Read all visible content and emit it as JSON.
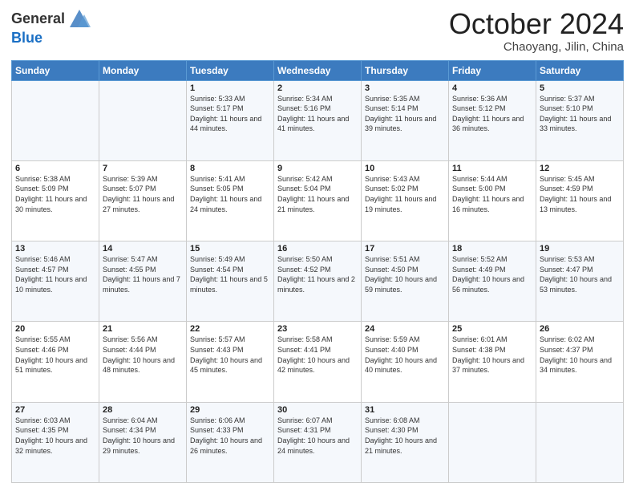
{
  "logo": {
    "general": "General",
    "blue": "Blue"
  },
  "header": {
    "month": "October 2024",
    "location": "Chaoyang, Jilin, China"
  },
  "weekdays": [
    "Sunday",
    "Monday",
    "Tuesday",
    "Wednesday",
    "Thursday",
    "Friday",
    "Saturday"
  ],
  "weeks": [
    [
      {
        "day": "",
        "sunrise": "",
        "sunset": "",
        "daylight": ""
      },
      {
        "day": "",
        "sunrise": "",
        "sunset": "",
        "daylight": ""
      },
      {
        "day": "1",
        "sunrise": "Sunrise: 5:33 AM",
        "sunset": "Sunset: 5:17 PM",
        "daylight": "Daylight: 11 hours and 44 minutes."
      },
      {
        "day": "2",
        "sunrise": "Sunrise: 5:34 AM",
        "sunset": "Sunset: 5:16 PM",
        "daylight": "Daylight: 11 hours and 41 minutes."
      },
      {
        "day": "3",
        "sunrise": "Sunrise: 5:35 AM",
        "sunset": "Sunset: 5:14 PM",
        "daylight": "Daylight: 11 hours and 39 minutes."
      },
      {
        "day": "4",
        "sunrise": "Sunrise: 5:36 AM",
        "sunset": "Sunset: 5:12 PM",
        "daylight": "Daylight: 11 hours and 36 minutes."
      },
      {
        "day": "5",
        "sunrise": "Sunrise: 5:37 AM",
        "sunset": "Sunset: 5:10 PM",
        "daylight": "Daylight: 11 hours and 33 minutes."
      }
    ],
    [
      {
        "day": "6",
        "sunrise": "Sunrise: 5:38 AM",
        "sunset": "Sunset: 5:09 PM",
        "daylight": "Daylight: 11 hours and 30 minutes."
      },
      {
        "day": "7",
        "sunrise": "Sunrise: 5:39 AM",
        "sunset": "Sunset: 5:07 PM",
        "daylight": "Daylight: 11 hours and 27 minutes."
      },
      {
        "day": "8",
        "sunrise": "Sunrise: 5:41 AM",
        "sunset": "Sunset: 5:05 PM",
        "daylight": "Daylight: 11 hours and 24 minutes."
      },
      {
        "day": "9",
        "sunrise": "Sunrise: 5:42 AM",
        "sunset": "Sunset: 5:04 PM",
        "daylight": "Daylight: 11 hours and 21 minutes."
      },
      {
        "day": "10",
        "sunrise": "Sunrise: 5:43 AM",
        "sunset": "Sunset: 5:02 PM",
        "daylight": "Daylight: 11 hours and 19 minutes."
      },
      {
        "day": "11",
        "sunrise": "Sunrise: 5:44 AM",
        "sunset": "Sunset: 5:00 PM",
        "daylight": "Daylight: 11 hours and 16 minutes."
      },
      {
        "day": "12",
        "sunrise": "Sunrise: 5:45 AM",
        "sunset": "Sunset: 4:59 PM",
        "daylight": "Daylight: 11 hours and 13 minutes."
      }
    ],
    [
      {
        "day": "13",
        "sunrise": "Sunrise: 5:46 AM",
        "sunset": "Sunset: 4:57 PM",
        "daylight": "Daylight: 11 hours and 10 minutes."
      },
      {
        "day": "14",
        "sunrise": "Sunrise: 5:47 AM",
        "sunset": "Sunset: 4:55 PM",
        "daylight": "Daylight: 11 hours and 7 minutes."
      },
      {
        "day": "15",
        "sunrise": "Sunrise: 5:49 AM",
        "sunset": "Sunset: 4:54 PM",
        "daylight": "Daylight: 11 hours and 5 minutes."
      },
      {
        "day": "16",
        "sunrise": "Sunrise: 5:50 AM",
        "sunset": "Sunset: 4:52 PM",
        "daylight": "Daylight: 11 hours and 2 minutes."
      },
      {
        "day": "17",
        "sunrise": "Sunrise: 5:51 AM",
        "sunset": "Sunset: 4:50 PM",
        "daylight": "Daylight: 10 hours and 59 minutes."
      },
      {
        "day": "18",
        "sunrise": "Sunrise: 5:52 AM",
        "sunset": "Sunset: 4:49 PM",
        "daylight": "Daylight: 10 hours and 56 minutes."
      },
      {
        "day": "19",
        "sunrise": "Sunrise: 5:53 AM",
        "sunset": "Sunset: 4:47 PM",
        "daylight": "Daylight: 10 hours and 53 minutes."
      }
    ],
    [
      {
        "day": "20",
        "sunrise": "Sunrise: 5:55 AM",
        "sunset": "Sunset: 4:46 PM",
        "daylight": "Daylight: 10 hours and 51 minutes."
      },
      {
        "day": "21",
        "sunrise": "Sunrise: 5:56 AM",
        "sunset": "Sunset: 4:44 PM",
        "daylight": "Daylight: 10 hours and 48 minutes."
      },
      {
        "day": "22",
        "sunrise": "Sunrise: 5:57 AM",
        "sunset": "Sunset: 4:43 PM",
        "daylight": "Daylight: 10 hours and 45 minutes."
      },
      {
        "day": "23",
        "sunrise": "Sunrise: 5:58 AM",
        "sunset": "Sunset: 4:41 PM",
        "daylight": "Daylight: 10 hours and 42 minutes."
      },
      {
        "day": "24",
        "sunrise": "Sunrise: 5:59 AM",
        "sunset": "Sunset: 4:40 PM",
        "daylight": "Daylight: 10 hours and 40 minutes."
      },
      {
        "day": "25",
        "sunrise": "Sunrise: 6:01 AM",
        "sunset": "Sunset: 4:38 PM",
        "daylight": "Daylight: 10 hours and 37 minutes."
      },
      {
        "day": "26",
        "sunrise": "Sunrise: 6:02 AM",
        "sunset": "Sunset: 4:37 PM",
        "daylight": "Daylight: 10 hours and 34 minutes."
      }
    ],
    [
      {
        "day": "27",
        "sunrise": "Sunrise: 6:03 AM",
        "sunset": "Sunset: 4:35 PM",
        "daylight": "Daylight: 10 hours and 32 minutes."
      },
      {
        "day": "28",
        "sunrise": "Sunrise: 6:04 AM",
        "sunset": "Sunset: 4:34 PM",
        "daylight": "Daylight: 10 hours and 29 minutes."
      },
      {
        "day": "29",
        "sunrise": "Sunrise: 6:06 AM",
        "sunset": "Sunset: 4:33 PM",
        "daylight": "Daylight: 10 hours and 26 minutes."
      },
      {
        "day": "30",
        "sunrise": "Sunrise: 6:07 AM",
        "sunset": "Sunset: 4:31 PM",
        "daylight": "Daylight: 10 hours and 24 minutes."
      },
      {
        "day": "31",
        "sunrise": "Sunrise: 6:08 AM",
        "sunset": "Sunset: 4:30 PM",
        "daylight": "Daylight: 10 hours and 21 minutes."
      },
      {
        "day": "",
        "sunrise": "",
        "sunset": "",
        "daylight": ""
      },
      {
        "day": "",
        "sunrise": "",
        "sunset": "",
        "daylight": ""
      }
    ]
  ]
}
